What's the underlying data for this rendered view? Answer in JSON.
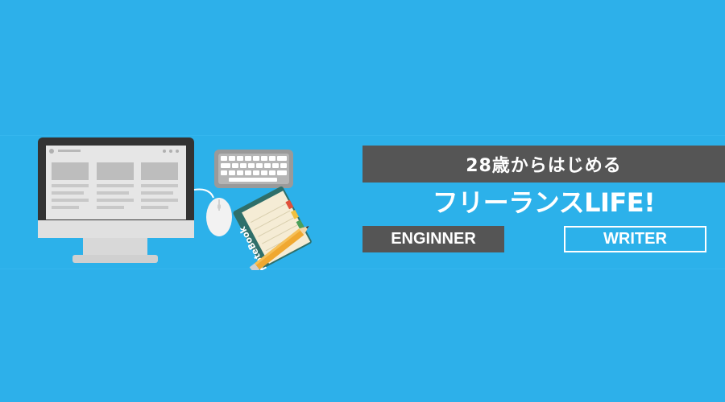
{
  "banner": {
    "subtitle": "28歳からはじめる",
    "title": "フリーランスLIFE!",
    "tags": [
      "ENGINNER",
      "WRITER"
    ]
  },
  "illustration": {
    "items": [
      "desktop-monitor",
      "keyboard",
      "mouse",
      "notebook",
      "pencil"
    ],
    "notebook_label": "NoteBook"
  },
  "colors": {
    "background": "#2db0ea",
    "dark_box": "#555555",
    "text": "#ffffff",
    "pencil": "#f0a830",
    "notebook_cover": "#2f6f6a"
  }
}
